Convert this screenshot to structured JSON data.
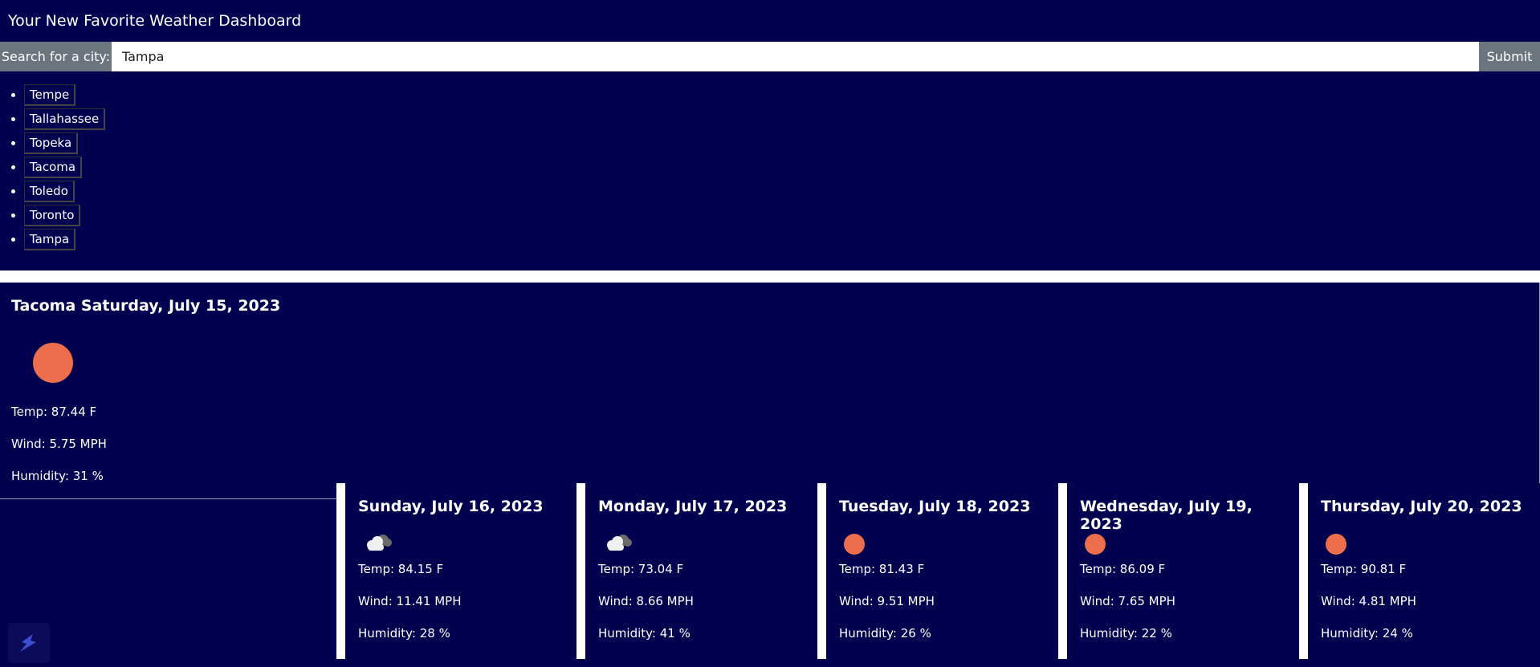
{
  "header": {
    "title": "Your New Favorite Weather Dashboard"
  },
  "search": {
    "label": "Search for a city:",
    "value": "Tampa",
    "submit_label": "Submit"
  },
  "history": [
    "Tempe",
    "Tallahassee",
    "Topeka",
    "Tacoma",
    "Toledo",
    "Toronto",
    "Tampa"
  ],
  "current": {
    "title": "Tacoma Saturday, July 15, 2023",
    "icon": "sun-icon",
    "temp": "Temp: 87.44 F",
    "wind": "Wind: 5.75 MPH",
    "humidity": "Humidity: 31 %"
  },
  "forecast": [
    {
      "date": "Sunday, July 16, 2023",
      "icon": "cloud-icon",
      "temp": "Temp: 84.15 F",
      "wind": "Wind: 11.41 MPH",
      "humidity": "Humidity: 28 %"
    },
    {
      "date": "Monday, July 17, 2023",
      "icon": "cloud-icon",
      "temp": "Temp: 73.04 F",
      "wind": "Wind: 8.66 MPH",
      "humidity": "Humidity: 41 %"
    },
    {
      "date": "Tuesday, July 18, 2023",
      "icon": "sun-icon",
      "temp": "Temp: 81.43 F",
      "wind": "Wind: 9.51 MPH",
      "humidity": "Humidity: 26 %"
    },
    {
      "date": "Wednesday, July 19, 2023",
      "icon": "sun-icon",
      "temp": "Temp: 86.09 F",
      "wind": "Wind: 7.65 MPH",
      "humidity": "Humidity: 22 %"
    },
    {
      "date": "Thursday, July 20, 2023",
      "icon": "sun-icon",
      "temp": "Temp: 90.81 F",
      "wind": "Wind: 4.81 MPH",
      "humidity": "Humidity: 24 %"
    }
  ],
  "colors": {
    "background": "#01014f",
    "sun": "#ec6e4c",
    "search_label_bg": "#6c757d"
  }
}
